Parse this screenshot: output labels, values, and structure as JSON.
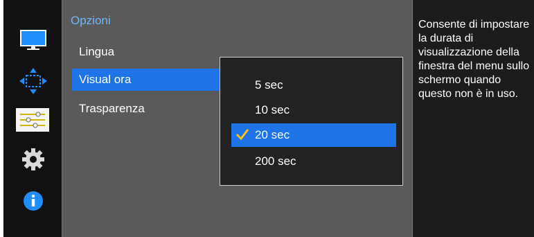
{
  "sidebar": {
    "items": [
      {
        "icon": "monitor-icon"
      },
      {
        "icon": "resize-arrows-icon"
      },
      {
        "icon": "settings-sliders-icon",
        "active": true
      },
      {
        "icon": "gear-icon"
      },
      {
        "icon": "info-icon"
      }
    ]
  },
  "menu": {
    "title": "Opzioni",
    "items": [
      {
        "label": "Lingua"
      },
      {
        "label": "Visual ora",
        "selected": true
      },
      {
        "label": "Trasparenza"
      }
    ]
  },
  "dropdown": {
    "options": [
      {
        "label": "5 sec"
      },
      {
        "label": "10 sec"
      },
      {
        "label": "20 sec",
        "selected": true
      },
      {
        "label": "200 sec"
      }
    ]
  },
  "description": {
    "text": "Consente di impostare la durata di visualizzazione della finestra del menu sullo schermo quando questo non è in uso."
  },
  "colors": {
    "accent": "#1e73e6",
    "title": "#6fb7ff",
    "check": "#f6c318",
    "panel": "#5a5a5a"
  }
}
